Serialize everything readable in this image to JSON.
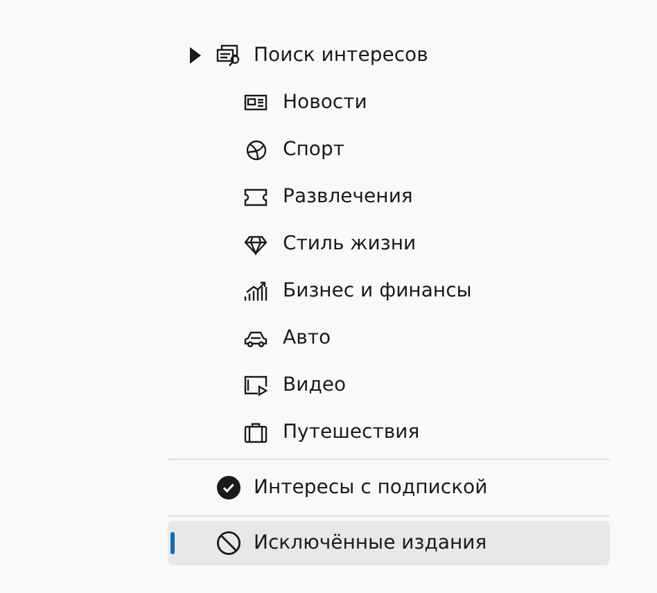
{
  "interests": {
    "label": "Поиск интересов",
    "items": [
      {
        "label": "Новости"
      },
      {
        "label": "Спорт"
      },
      {
        "label": "Развлечения"
      },
      {
        "label": "Стиль жизни"
      },
      {
        "label": "Бизнес и финансы"
      },
      {
        "label": "Авто"
      },
      {
        "label": "Видео"
      },
      {
        "label": "Путешествия"
      }
    ]
  },
  "sections": [
    {
      "label": "Интересы с подпиской",
      "kind": "check",
      "selected": false
    },
    {
      "label": "Исключённые издания",
      "kind": "block",
      "selected": true
    }
  ]
}
